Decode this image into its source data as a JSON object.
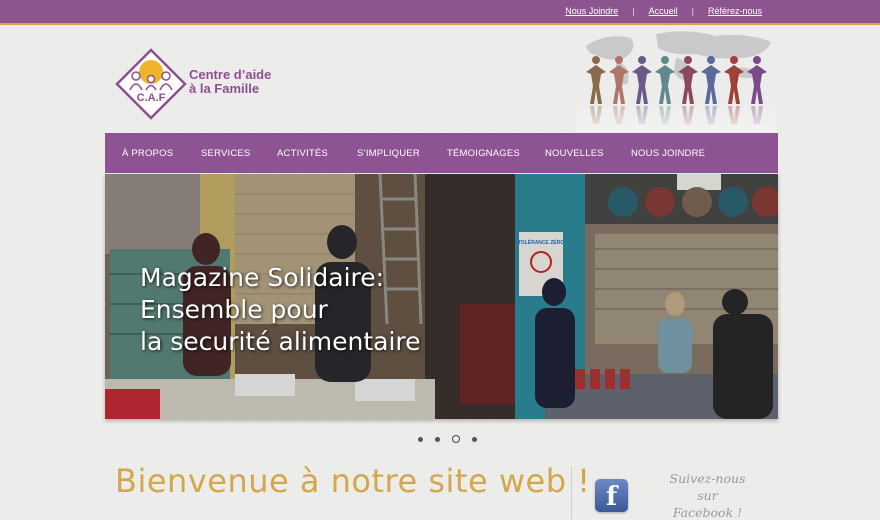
{
  "topbar": {
    "links": [
      "Nous Joindre",
      "Accueil",
      "Référez-nous"
    ],
    "separator": "|"
  },
  "logo": {
    "letters": "C.A.F",
    "line1": "Centre d’aide",
    "line2": "à la Famille"
  },
  "nav": {
    "items": [
      "À PROPOS",
      "SERVICES",
      "ACTIVITÉS",
      "S’IMPLIQUER",
      "TÉMOIGNAGES",
      "NOUVELLES",
      "NOUS JOINDRE"
    ]
  },
  "slider": {
    "caption_lines": [
      "Magazine Solidaire:",
      "Ensemble pour",
      "la securité alimentaire"
    ],
    "poster_text": "TOLÉRANCE ZÉRO"
  },
  "welcome": {
    "title": "Bienvenue à notre site web !"
  },
  "social": {
    "facebook_letter": "f",
    "follow_lines": [
      "Suivez-nous",
      "sur",
      "Facebook !"
    ]
  },
  "colors": {
    "brand_purple": "#8c5590",
    "gold": "#d4a84a"
  }
}
